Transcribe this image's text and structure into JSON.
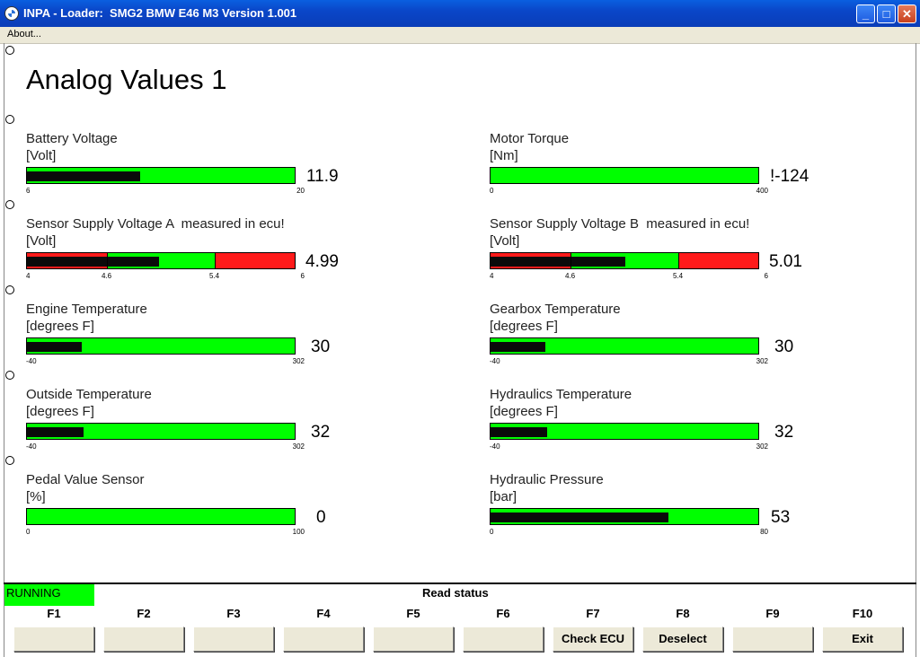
{
  "window": {
    "title": "INPA - Loader:  SMG2 BMW E46 M3 Version 1.001"
  },
  "menu": {
    "about_label": "About..."
  },
  "page": {
    "title": "Analog Values 1"
  },
  "gauges": [
    {
      "label": "Battery Voltage",
      "unit": "[Volt]",
      "value": "11.9",
      "min": 6,
      "max": 20,
      "fill_fraction": 0.42,
      "ticks": [
        "6",
        "20"
      ]
    },
    {
      "label": "Motor Torque",
      "unit": "[Nm]",
      "value": "!-124",
      "min": 0,
      "max": 400,
      "fill_fraction": 0,
      "ticks": [
        "0",
        "400"
      ]
    },
    {
      "label": "Sensor Supply Voltage A  measured in ecu!",
      "unit": "[Volt]",
      "value": "4.99",
      "min": 4,
      "max": 6,
      "fill_fraction": 0.49,
      "ticks": [
        "4",
        "4.6",
        "5.4",
        "6"
      ],
      "ok_range": [
        4.6,
        5.4
      ]
    },
    {
      "label": "Sensor Supply Voltage B  measured in ecu!",
      "unit": "[Volt]",
      "value": "5.01",
      "min": 4,
      "max": 6,
      "fill_fraction": 0.5,
      "ticks": [
        "4",
        "4.6",
        "5.4",
        "6"
      ],
      "ok_range": [
        4.6,
        5.4
      ]
    },
    {
      "label": "Engine Temperature",
      "unit": "[degrees F]",
      "value": "30",
      "min": -40,
      "max": 302,
      "fill_fraction": 0.205,
      "ticks": [
        "-40",
        "302"
      ]
    },
    {
      "label": "Gearbox Temperature",
      "unit": "[degrees F]",
      "value": "30",
      "min": -40,
      "max": 302,
      "fill_fraction": 0.205,
      "ticks": [
        "-40",
        "302"
      ]
    },
    {
      "label": "Outside Temperature",
      "unit": "[degrees F]",
      "value": "32",
      "min": -40,
      "max": 302,
      "fill_fraction": 0.21,
      "ticks": [
        "-40",
        "302"
      ]
    },
    {
      "label": "Hydraulics Temperature",
      "unit": "[degrees F]",
      "value": "32",
      "min": -40,
      "max": 302,
      "fill_fraction": 0.21,
      "ticks": [
        "-40",
        "302"
      ]
    },
    {
      "label": "Pedal Value Sensor",
      "unit": "[%]",
      "value": "0",
      "min": 0,
      "max": 100,
      "fill_fraction": 0,
      "ticks": [
        "0",
        "100"
      ]
    },
    {
      "label": "Hydraulic Pressure",
      "unit": "[bar]",
      "value": "53",
      "min": 0,
      "max": 80,
      "fill_fraction": 0.66,
      "ticks": [
        "0",
        "80"
      ]
    }
  ],
  "status": {
    "state": "RUNNING",
    "message": "Read status"
  },
  "fkeys": [
    {
      "key": "F1",
      "label": ""
    },
    {
      "key": "F2",
      "label": ""
    },
    {
      "key": "F3",
      "label": ""
    },
    {
      "key": "F4",
      "label": ""
    },
    {
      "key": "F5",
      "label": ""
    },
    {
      "key": "F6",
      "label": ""
    },
    {
      "key": "F7",
      "label": "Check ECU"
    },
    {
      "key": "F8",
      "label": "Deselect"
    },
    {
      "key": "F9",
      "label": ""
    },
    {
      "key": "F10",
      "label": "Exit"
    }
  ],
  "colors": {
    "ok": "#00ff00",
    "warn": "#ff1a1a",
    "fill": "#0a0a0a",
    "titlebar": "#0a46c8",
    "running": "#00ff00"
  }
}
